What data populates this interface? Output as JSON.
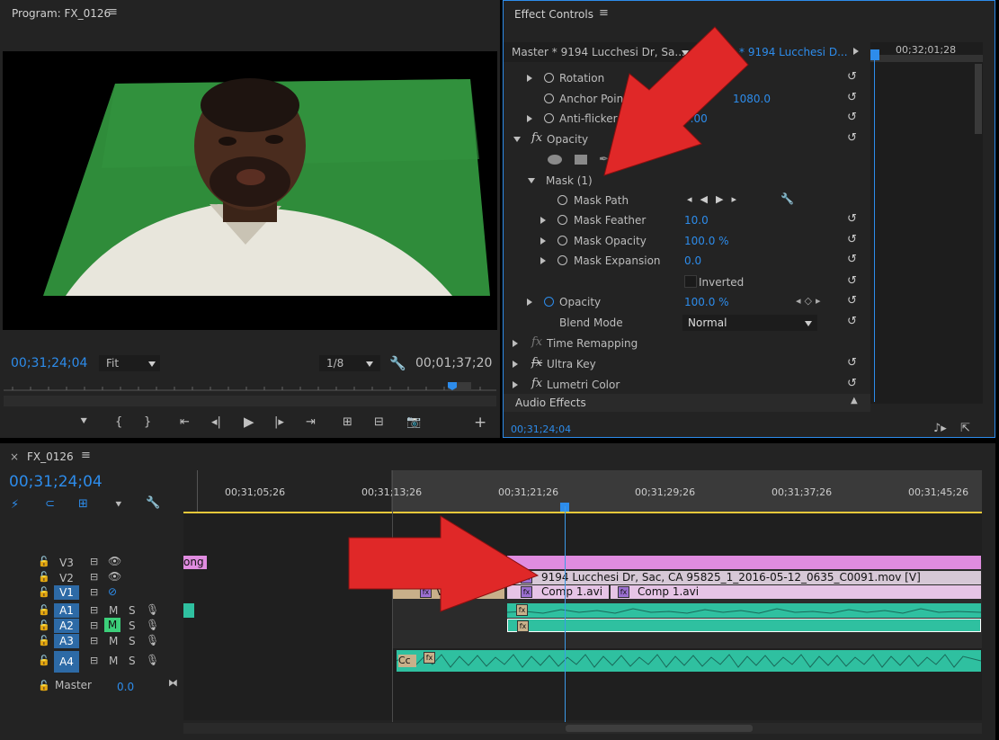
{
  "program": {
    "title": "Program: FX_0126",
    "timecode_left": "00;31;24;04",
    "fit_label": "Fit",
    "res_label": "1/8",
    "timecode_right": "00;01;37;20"
  },
  "effect_controls": {
    "title": "Effect Controls",
    "master_label": "Master * 9194 Lucchesi Dr, Sa...",
    "clip_label": "* 9194 Lucchesi D...",
    "ruler_time": "00;32;01;28",
    "rows": {
      "rotation": "Rotation",
      "anchor_point": "Anchor Point",
      "anchor_value": "1080.0",
      "anti_flicker": "Anti-flicker",
      "anti_flicker_value": "0.00",
      "opacity_group": "Opacity",
      "mask": "Mask (1)",
      "mask_path": "Mask Path",
      "mask_feather": "Mask Feather",
      "mask_feather_value": "10.0",
      "mask_opacity": "Mask Opacity",
      "mask_opacity_value": "100.0 %",
      "mask_expansion": "Mask Expansion",
      "mask_expansion_value": "0.0",
      "inverted": "Inverted",
      "opacity": "Opacity",
      "opacity_value": "100.0 %",
      "blend_mode": "Blend Mode",
      "blend_mode_value": "Normal",
      "time_remapping": "Time Remapping",
      "ultra_key": "Ultra Key",
      "lumetri": "Lumetri Color",
      "audio_effects": "Audio Effects"
    },
    "timecode": "00;31;24;04"
  },
  "timeline": {
    "tab": "FX_0126",
    "timecode": "00;31;24;04",
    "ruler": [
      "00;31;05;26",
      "00;31;13;26",
      "00;31;21;26",
      "00;31;29;26",
      "00;31;37;26",
      "00;31;45;26"
    ],
    "tracks": {
      "v3": "V3",
      "v2": "V2",
      "v1": "V1",
      "a1": "A1",
      "a2": "A2",
      "a3": "A3",
      "a4": "A4",
      "master": "Master",
      "master_value": "0.0",
      "m": "M",
      "s": "S"
    },
    "clips": {
      "pink_partial": "ong",
      "v2_clip": "9194 Lucchesi Dr, Sac, CA 95825_1_2016-05-12_0635_C0091.mov [V]",
      "v1_comp1": "Comp 1.avi",
      "v1_comp2": "Comp 1.avi",
      "v1_small": "V",
      "a4_small": "Cc"
    }
  },
  "colors": {
    "accent": "#2d8ceb",
    "clip_pink": "#e08ce0",
    "clip_v": "#e6c4e6",
    "audio": "#2fc0a0",
    "arrow": "#e02828",
    "green_screen": "#2f8c3a",
    "playhead_line": "#3c9ae8",
    "work_area": "#e8c83a"
  }
}
